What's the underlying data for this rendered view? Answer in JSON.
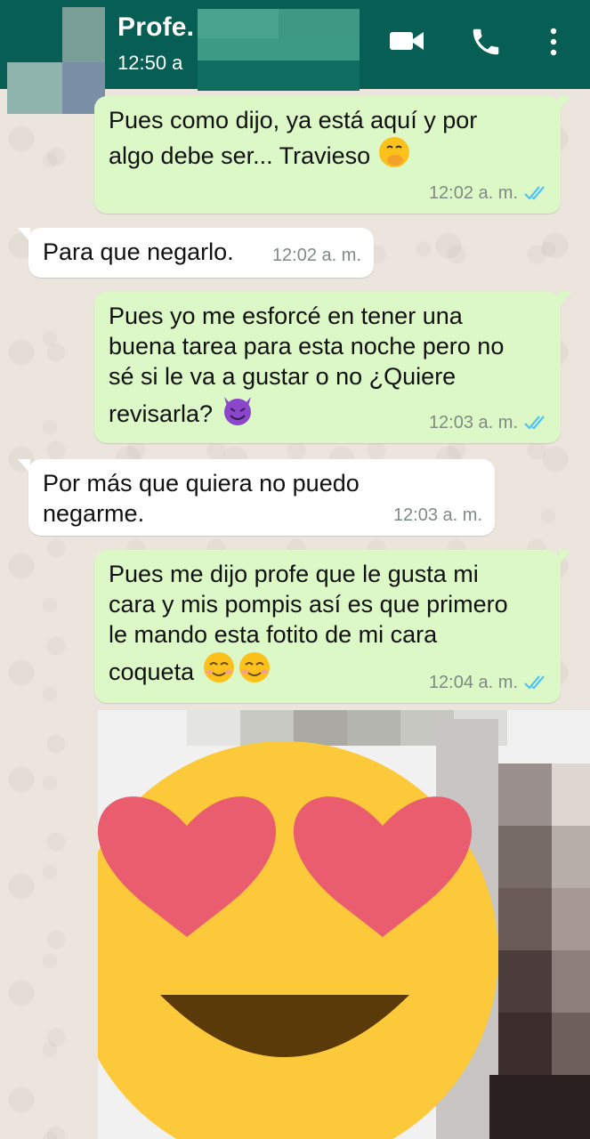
{
  "header": {
    "contact_name": "Profe.",
    "last_seen": "12:50 a"
  },
  "messages": [
    {
      "direction": "outgoing",
      "text": "Pues como dijo, ya está aquí y por\nalgo debe ser... Travieso",
      "emoji": "face-with-hand-over-mouth",
      "time": "12:02 a. m.",
      "status": "read"
    },
    {
      "direction": "incoming",
      "text": "Para que negarlo.",
      "time": "12:02 a. m."
    },
    {
      "direction": "outgoing",
      "text": "Pues yo me esforcé en tener una\nbuena tarea para esta noche pero no\nsé si le va a gustar o no ¿Quiere\nrevisarla?",
      "emoji": "smiling-devil",
      "time": "12:03 a. m.",
      "status": "read"
    },
    {
      "direction": "incoming",
      "text": "Por más que quiera no puedo\nnegarme.",
      "time": "12:03 a. m."
    },
    {
      "direction": "outgoing",
      "text": "Pues me dijo profe que le gusta mi\ncara y mis pompis así es que primero\nle mando esta fotito de mi cara\ncoqueta",
      "emoji": "smiling-face x2",
      "time": "12:04 a. m.",
      "status": "read"
    }
  ],
  "photo": {
    "overlay": "heart-eyes-emoji",
    "censored": true
  },
  "colors": {
    "header": "#075e54",
    "outgoing_bubble": "#dcf8c6",
    "incoming_bubble": "#ffffff",
    "read_ticks": "#4fc3f7",
    "chat_background": "#ece5dd"
  }
}
